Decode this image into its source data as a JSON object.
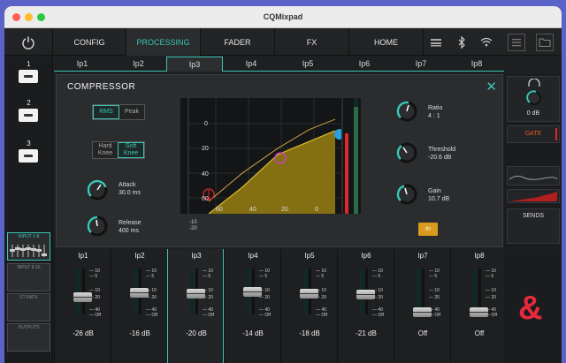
{
  "window": {
    "title": "CQMixpad"
  },
  "nav": {
    "tabs": [
      {
        "label": "CONFIG"
      },
      {
        "label": "PROCESSING"
      },
      {
        "label": "FADER"
      },
      {
        "label": "FX"
      },
      {
        "label": "HOME"
      }
    ],
    "active_tab": "PROCESSING"
  },
  "left_panel": {
    "banks": [
      {
        "label": "1"
      },
      {
        "label": "2"
      },
      {
        "label": "3"
      }
    ],
    "layer_labels": [
      "INPUT 1-8",
      "INPUT 9-16",
      "ST IN/FX",
      "OUTPUTS"
    ]
  },
  "channel_tabs": [
    "Ip1",
    "Ip2",
    "Ip3",
    "Ip4",
    "Ip5",
    "Ip6",
    "Ip7",
    "Ip8"
  ],
  "active_channel": "Ip3",
  "compressor": {
    "title": "COMPRESSOR",
    "mode": {
      "option_a": "RMS",
      "option_b": "Peak"
    },
    "knee": {
      "option_a": "Hard Knee",
      "option_b": "Soft Knee"
    },
    "attack": {
      "label": "Attack",
      "value": "30.0 ms"
    },
    "release": {
      "label": "Release",
      "value": "400 ms"
    },
    "ratio": {
      "label": "Ratio",
      "value": "4 : 1"
    },
    "threshold": {
      "label": "Threshold",
      "value": "-20.6 dB"
    },
    "gain": {
      "label": "Gain",
      "value": "10.7 dB"
    },
    "in_button": "In",
    "graph_y_labels": [
      "0",
      "20",
      "40",
      "60"
    ],
    "graph_x_labels": [
      "60",
      "40",
      "20",
      "0"
    ],
    "below_labels": [
      "-10",
      "-20"
    ]
  },
  "right_panel": {
    "gain_value": "0 dB",
    "gate_label": "GATE",
    "sends_label": "SENDS"
  },
  "strips": [
    {
      "name": "Ip1",
      "value": "-26 dB",
      "level": 0.35
    },
    {
      "name": "Ip2",
      "value": "-16 dB",
      "level": 0.45
    },
    {
      "name": "Ip3",
      "value": "-20 dB",
      "level": 0.42
    },
    {
      "name": "Ip4",
      "value": "-14 dB",
      "level": 0.47
    },
    {
      "name": "Ip5",
      "value": "-18 dB",
      "level": 0.43
    },
    {
      "name": "Ip6",
      "value": "-21 dB",
      "level": 0.41
    },
    {
      "name": "Ip7",
      "value": "Off",
      "level": 0.0
    },
    {
      "name": "Ip8",
      "value": "Off",
      "level": 0.0
    }
  ],
  "fader_scale": [
    "10",
    "5",
    "10",
    "20",
    "40",
    "Off"
  ],
  "colors": {
    "accent": "#39c6b6",
    "in_button": "#d89b1f",
    "logo": "#e8283c",
    "desktop": "#5b63c9"
  }
}
